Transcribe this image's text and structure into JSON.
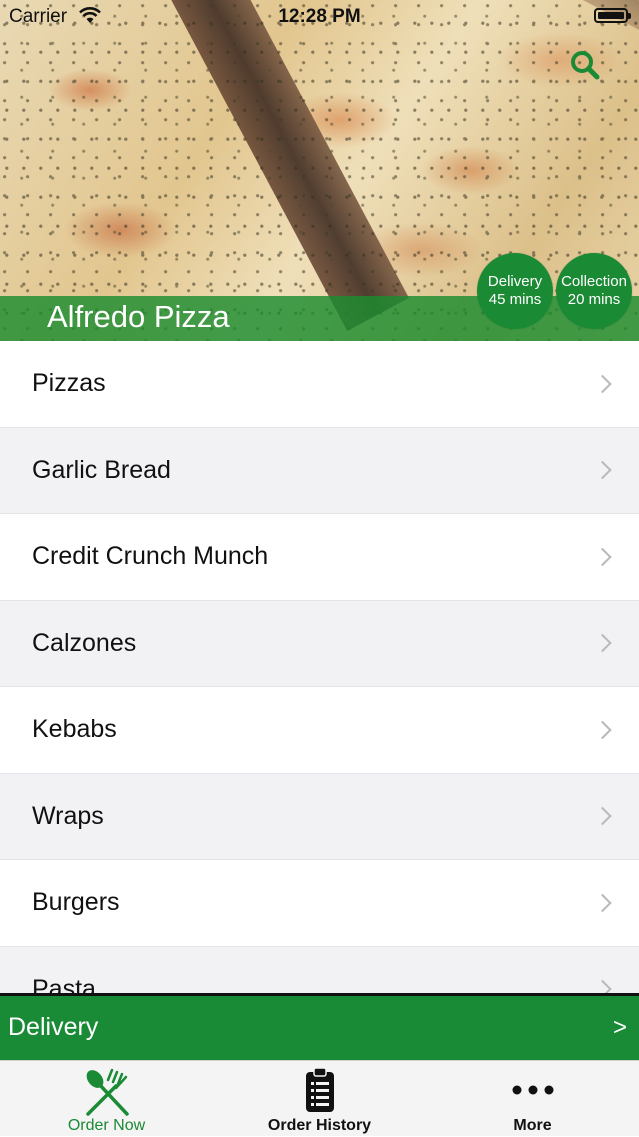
{
  "status_bar": {
    "carrier": "Carrier",
    "time": "12:28 PM"
  },
  "header": {
    "store_name": "Alfredo Pizza",
    "search_icon": "search-icon",
    "delivery_badge": {
      "label": "Delivery",
      "time": "45 mins"
    },
    "collection_badge": {
      "label": "Collection",
      "time": "20 mins"
    }
  },
  "menu": {
    "categories": [
      {
        "label": "Pizzas"
      },
      {
        "label": "Garlic Bread"
      },
      {
        "label": "Credit Crunch Munch"
      },
      {
        "label": "Calzones"
      },
      {
        "label": "Kebabs"
      },
      {
        "label": "Wraps"
      },
      {
        "label": "Burgers"
      },
      {
        "label": "Pasta"
      }
    ]
  },
  "delivery_bar": {
    "label": "Delivery",
    "arrow": ">"
  },
  "tab_bar": {
    "tabs": [
      {
        "label": "Order Now",
        "icon": "fork-knife-icon",
        "active": true
      },
      {
        "label": "Order History",
        "icon": "clipboard-list-icon",
        "active": false
      },
      {
        "label": "More",
        "icon": "more-dots-icon",
        "active": false
      }
    ]
  },
  "colors": {
    "brand_green": "#1a8a34",
    "chevron": "#b8b8bd",
    "row_alt": "#f2f2f5"
  }
}
